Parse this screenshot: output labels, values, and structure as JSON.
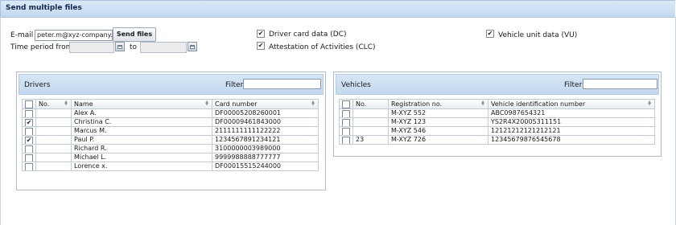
{
  "title": "Send multiple files",
  "form": {
    "email_label": "E-mail",
    "email_value": "peter.m@xyz-company.",
    "send_button": "Send files",
    "time_label": "Time period from",
    "to_label": "to",
    "from_value": "",
    "to_value": ""
  },
  "options": {
    "driver_card": {
      "label": "Driver card data (DC)",
      "checked": true
    },
    "attestation": {
      "label": "Attestation of Activities (CLC)",
      "checked": true
    },
    "vehicle_unit": {
      "label": "Vehicle unit data (VU)",
      "checked": true
    }
  },
  "drivers": {
    "title": "Drivers",
    "filter_label": "Filter",
    "filter_value": "",
    "columns": [
      "No.",
      "Name",
      "Card number"
    ],
    "rows": [
      {
        "checked": false,
        "no": "",
        "name": "Alex A.",
        "card": "DF00005208260001"
      },
      {
        "checked": true,
        "no": "",
        "name": "Christina C.",
        "card": "DF00009461843000"
      },
      {
        "checked": false,
        "no": "",
        "name": "Marcus M.",
        "card": "2111111111122222"
      },
      {
        "checked": true,
        "no": "",
        "name": "Paul P.",
        "card": "1234567891234121"
      },
      {
        "checked": false,
        "no": "",
        "name": "Richard R.",
        "card": "3100000003989000"
      },
      {
        "checked": false,
        "no": "",
        "name": "Michael L.",
        "card": "9999988888777777"
      },
      {
        "checked": false,
        "no": "",
        "name": "Lorence x.",
        "card": "DF00015515244000"
      }
    ]
  },
  "vehicles": {
    "title": "Vehicles",
    "filter_label": "Filter",
    "filter_value": "",
    "columns": [
      "No.",
      "Registration no.",
      "Vehicle identification number"
    ],
    "rows": [
      {
        "checked": false,
        "no": "",
        "reg": "M-XYZ 552",
        "vin": "ABC0987654321"
      },
      {
        "checked": false,
        "no": "",
        "reg": "M-XYZ 123",
        "vin": "YS2R4X20005311151"
      },
      {
        "checked": false,
        "no": "",
        "reg": "M-XYZ 546",
        "vin": "12121212121212121"
      },
      {
        "checked": false,
        "no": "23",
        "reg": "M-XYZ 726",
        "vin": "12345679876545678"
      }
    ]
  }
}
